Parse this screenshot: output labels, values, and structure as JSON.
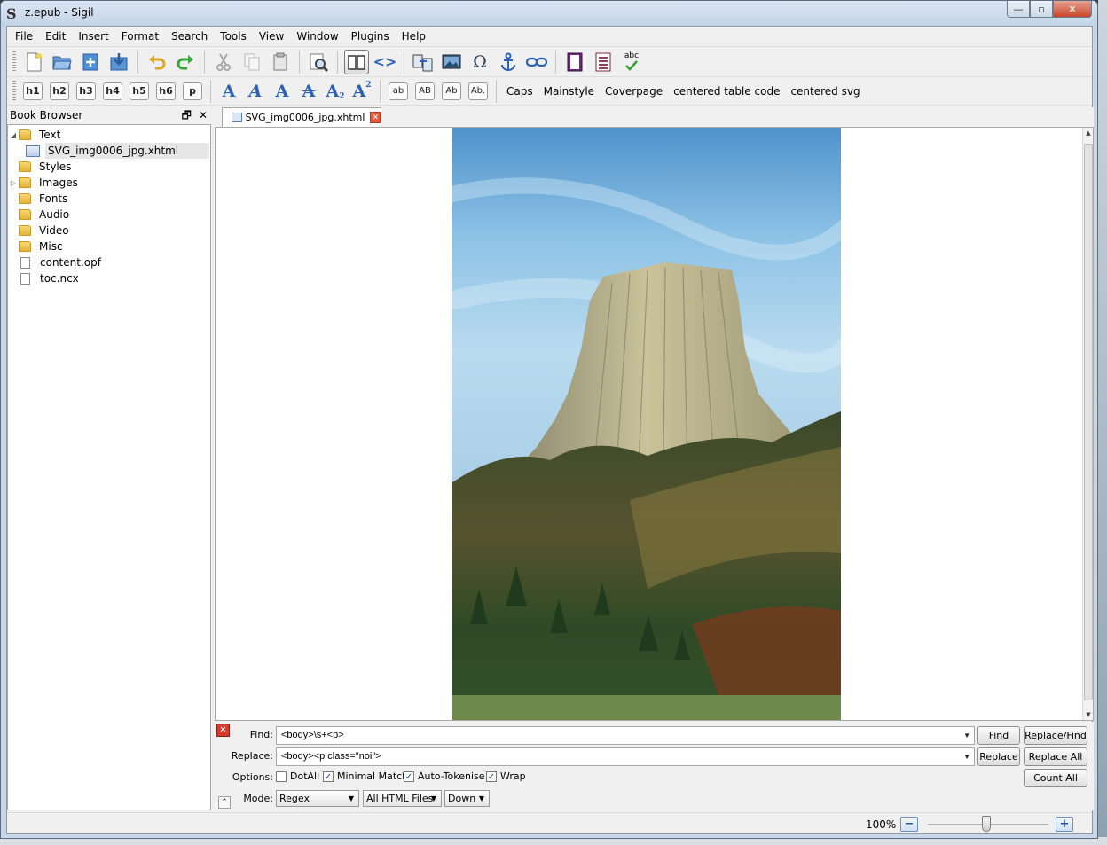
{
  "window": {
    "title": "z.epub - Sigil",
    "app_icon": "S",
    "minimize_glyph": "—",
    "maximize_glyph": "▫",
    "close_glyph": "✕"
  },
  "menubar": [
    "File",
    "Edit",
    "Insert",
    "Format",
    "Search",
    "Tools",
    "View",
    "Window",
    "Plugins",
    "Help"
  ],
  "toolbar_main": {
    "icons": [
      "new-file-icon",
      "open-folder-icon",
      "add-file-icon",
      "save-icon",
      "undo-icon",
      "redo-icon",
      "cut-icon",
      "copy-icon",
      "paste-icon",
      "preview-icon",
      "book-view-icon",
      "code-view-icon",
      "split-icon",
      "insert-image-icon",
      "insert-special-char-icon",
      "insert-anchor-icon",
      "insert-link-icon",
      "metadata-icon",
      "toc-icon",
      "spellcheck-icon"
    ],
    "omega": "Ω",
    "code_view": "<>",
    "spellcheck_text": "abc",
    "metadata_text": "i"
  },
  "toolbar_format": {
    "headings": [
      "h1",
      "h2",
      "h3",
      "h4",
      "h5",
      "h6",
      "p"
    ],
    "text_styles": [
      "A",
      "A",
      "A",
      "A",
      "A",
      "A"
    ],
    "sub_mark": "2",
    "sup_mark": "2",
    "case_buttons": [
      "ab",
      "AB",
      "Ab",
      "Ab."
    ],
    "clips": [
      "Caps",
      "Mainstyle",
      "Coverpage",
      "centered table code",
      "centered svg"
    ]
  },
  "book_browser": {
    "title": "Book Browser",
    "float_glyph": "🗗",
    "close_glyph": "✕",
    "tree": [
      {
        "label": "Text",
        "type": "folder",
        "expanded": true,
        "has_arrow": true
      },
      {
        "label": "SVG_img0006_jpg.xhtml",
        "type": "xhtml",
        "selected": true
      },
      {
        "label": "Styles",
        "type": "folder"
      },
      {
        "label": "Images",
        "type": "folder",
        "has_arrow": true
      },
      {
        "label": "Fonts",
        "type": "folder"
      },
      {
        "label": "Audio",
        "type": "folder"
      },
      {
        "label": "Video",
        "type": "folder"
      },
      {
        "label": "Misc",
        "type": "folder"
      },
      {
        "label": "content.opf",
        "type": "file"
      },
      {
        "label": "toc.ncx",
        "type": "file"
      }
    ]
  },
  "editor": {
    "tab_label": "SVG_img0006_jpg.xhtml",
    "tab_close_glyph": "✕",
    "image_description_icon": "landscape-photo"
  },
  "find_replace": {
    "close_glyph": "✕",
    "find_label": "Find:",
    "find_value": "<body>\\s+<p>",
    "replace_label": "Replace:",
    "replace_value": "<body><p class=\"noi\">",
    "options_label": "Options:",
    "options": [
      {
        "label": "DotAll",
        "checked": false
      },
      {
        "label": "Minimal Match",
        "checked": true
      },
      {
        "label": "Auto-Tokenise",
        "checked": true
      },
      {
        "label": "Wrap",
        "checked": true
      }
    ],
    "mode_label": "Mode:",
    "mode_value": "Regex",
    "scope_value": "All HTML Files",
    "direction_value": "Down",
    "buttons": {
      "find": "Find",
      "replace_find": "Replace/Find",
      "replace": "Replace",
      "replace_all": "Replace All",
      "count_all": "Count All"
    }
  },
  "statusbar": {
    "zoom": "100%",
    "zoom_level": 0.55,
    "zoom_out_glyph": "−",
    "zoom_in_glyph": "+"
  },
  "colors": {
    "accent_blue": "#2b62b8",
    "close_red": "#d63a2a"
  }
}
